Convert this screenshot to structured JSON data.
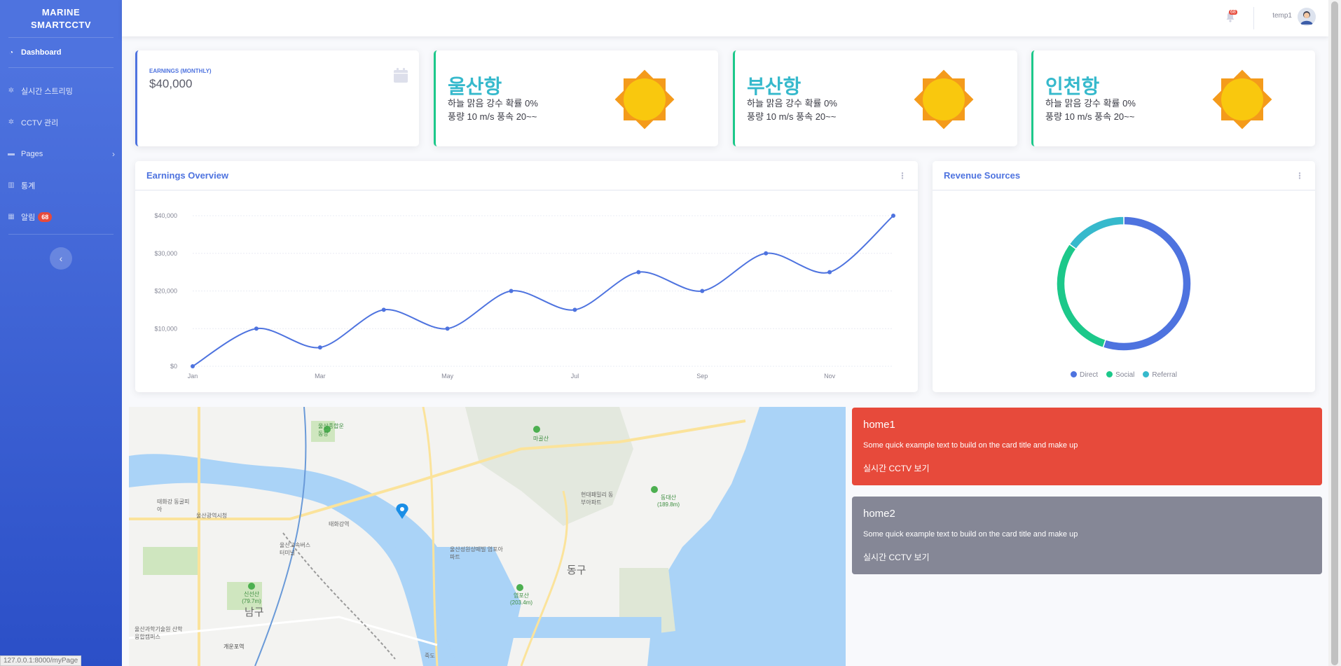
{
  "sidebar": {
    "brand_line1": "MARINE",
    "brand_line2": "SMARTCCTV",
    "items": [
      {
        "label": "Dashboard",
        "icon": "tachometer-icon"
      },
      {
        "label": "실시간 스트리밍",
        "icon": "gear-icon"
      },
      {
        "label": "CCTV 관리",
        "icon": "gear-icon"
      },
      {
        "label": "Pages",
        "icon": "folder-icon"
      },
      {
        "label": "통계",
        "icon": "chart-icon"
      },
      {
        "label": "알림",
        "icon": "table-icon",
        "badge": "68"
      }
    ],
    "toggle_icon": "‹",
    "status_url": "127.0.0.1:8000/myPage"
  },
  "topbar": {
    "alert_count": "68",
    "username": "temp1"
  },
  "stats": {
    "label": "EARNINGS (MONTHLY)",
    "value": "$40,000"
  },
  "weather": [
    {
      "city": "울산항",
      "line1": "하늘 맑음 강수 확률 0%",
      "line2": "풍량 10 m/s 풍속 20~~"
    },
    {
      "city": "부산항",
      "line1": "하늘 맑음 강수 확률 0%",
      "line2": "풍량 10 m/s 풍속 20~~"
    },
    {
      "city": "인천항",
      "line1": "하늘 맑음 강수 확률 0%",
      "line2": "풍량 10 m/s 풍속 20~~"
    }
  ],
  "earnings": {
    "title": "Earnings Overview"
  },
  "revenue": {
    "title": "Revenue Sources"
  },
  "chart_data": [
    {
      "type": "line",
      "categories": [
        "Jan",
        "Feb",
        "Mar",
        "Apr",
        "May",
        "Jun",
        "Jul",
        "Aug",
        "Sep",
        "Oct",
        "Nov",
        "Dec"
      ],
      "tick_labels_x": [
        "Jan",
        "Mar",
        "May",
        "Jul",
        "Sep",
        "Nov"
      ],
      "series": [
        {
          "values": [
            0,
            10000,
            5000,
            15000,
            10000,
            20000,
            15000,
            25000,
            20000,
            30000,
            25000,
            40000
          ]
        }
      ],
      "yticks": [
        "$0",
        "$10,000",
        "$20,000",
        "$30,000",
        "$40,000"
      ],
      "ylim": [
        0,
        40000
      ],
      "color": "#4e73df"
    },
    {
      "type": "pie",
      "labels": [
        "Direct",
        "Social",
        "Referral"
      ],
      "values": [
        55,
        30,
        15
      ],
      "colors": [
        "#4e73df",
        "#1cc88a",
        "#36b9cc"
      ]
    }
  ],
  "map": {
    "labels": {
      "dong_gu": "동구",
      "nam_gu": "남구",
      "mt_1": "마골산",
      "mt_2": "동대산 (189.8m)",
      "mt_3": "염포산 (203.4m)",
      "mt_4": "신선산 (79.7m)",
      "area_1": "울산종합운동장",
      "area_2": "울산광역시청",
      "area_3": "태화강역",
      "area_4": "울산고속버스터미널",
      "area_5": "현대패밀리 동부아파트",
      "area_6": "울산성원상떼빌 염포아파트",
      "area_7": "죽도",
      "area_8": "울산과학기술원 산학융합캠퍼스",
      "area_9": "태화강 동굴피아",
      "area_10": "개운포역"
    }
  },
  "homes": [
    {
      "title": "home1",
      "text": "Some quick example text to build on the card title and make up",
      "link": "실시간 CCTV 보기",
      "color": "#e74a3b"
    },
    {
      "title": "home2",
      "text": "Some quick example text to build on the card title and make up",
      "link": "실시간 CCTV 보기",
      "color": "#858796"
    }
  ]
}
